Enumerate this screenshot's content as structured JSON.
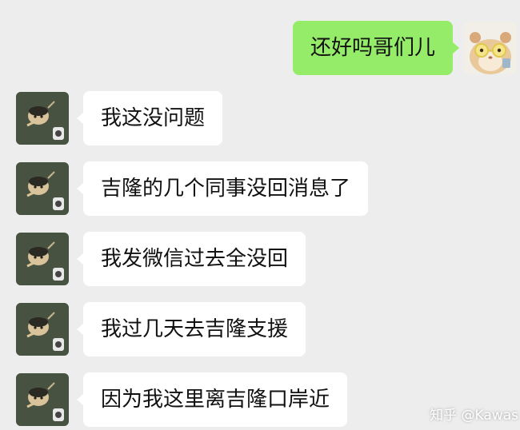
{
  "messages": [
    {
      "side": "out",
      "text": "还好吗哥们儿"
    },
    {
      "side": "in",
      "text": "我这没问题"
    },
    {
      "side": "in",
      "text": "吉隆的几个同事没回消息了"
    },
    {
      "side": "in",
      "text": "我发微信过去全没回"
    },
    {
      "side": "in",
      "text": "我过几天去吉隆支援"
    },
    {
      "side": "in",
      "text": "因为我这里离吉隆口岸近"
    }
  ],
  "watermark": "知乎 @Kawas",
  "colors": {
    "background": "#ededed",
    "incoming_bubble": "#ffffff",
    "outgoing_bubble": "#95ec69"
  },
  "icons": {
    "self_avatar": "hamster-with-glasses-avatar",
    "contact_avatar": "cartoon-character-dark-green-avatar"
  }
}
